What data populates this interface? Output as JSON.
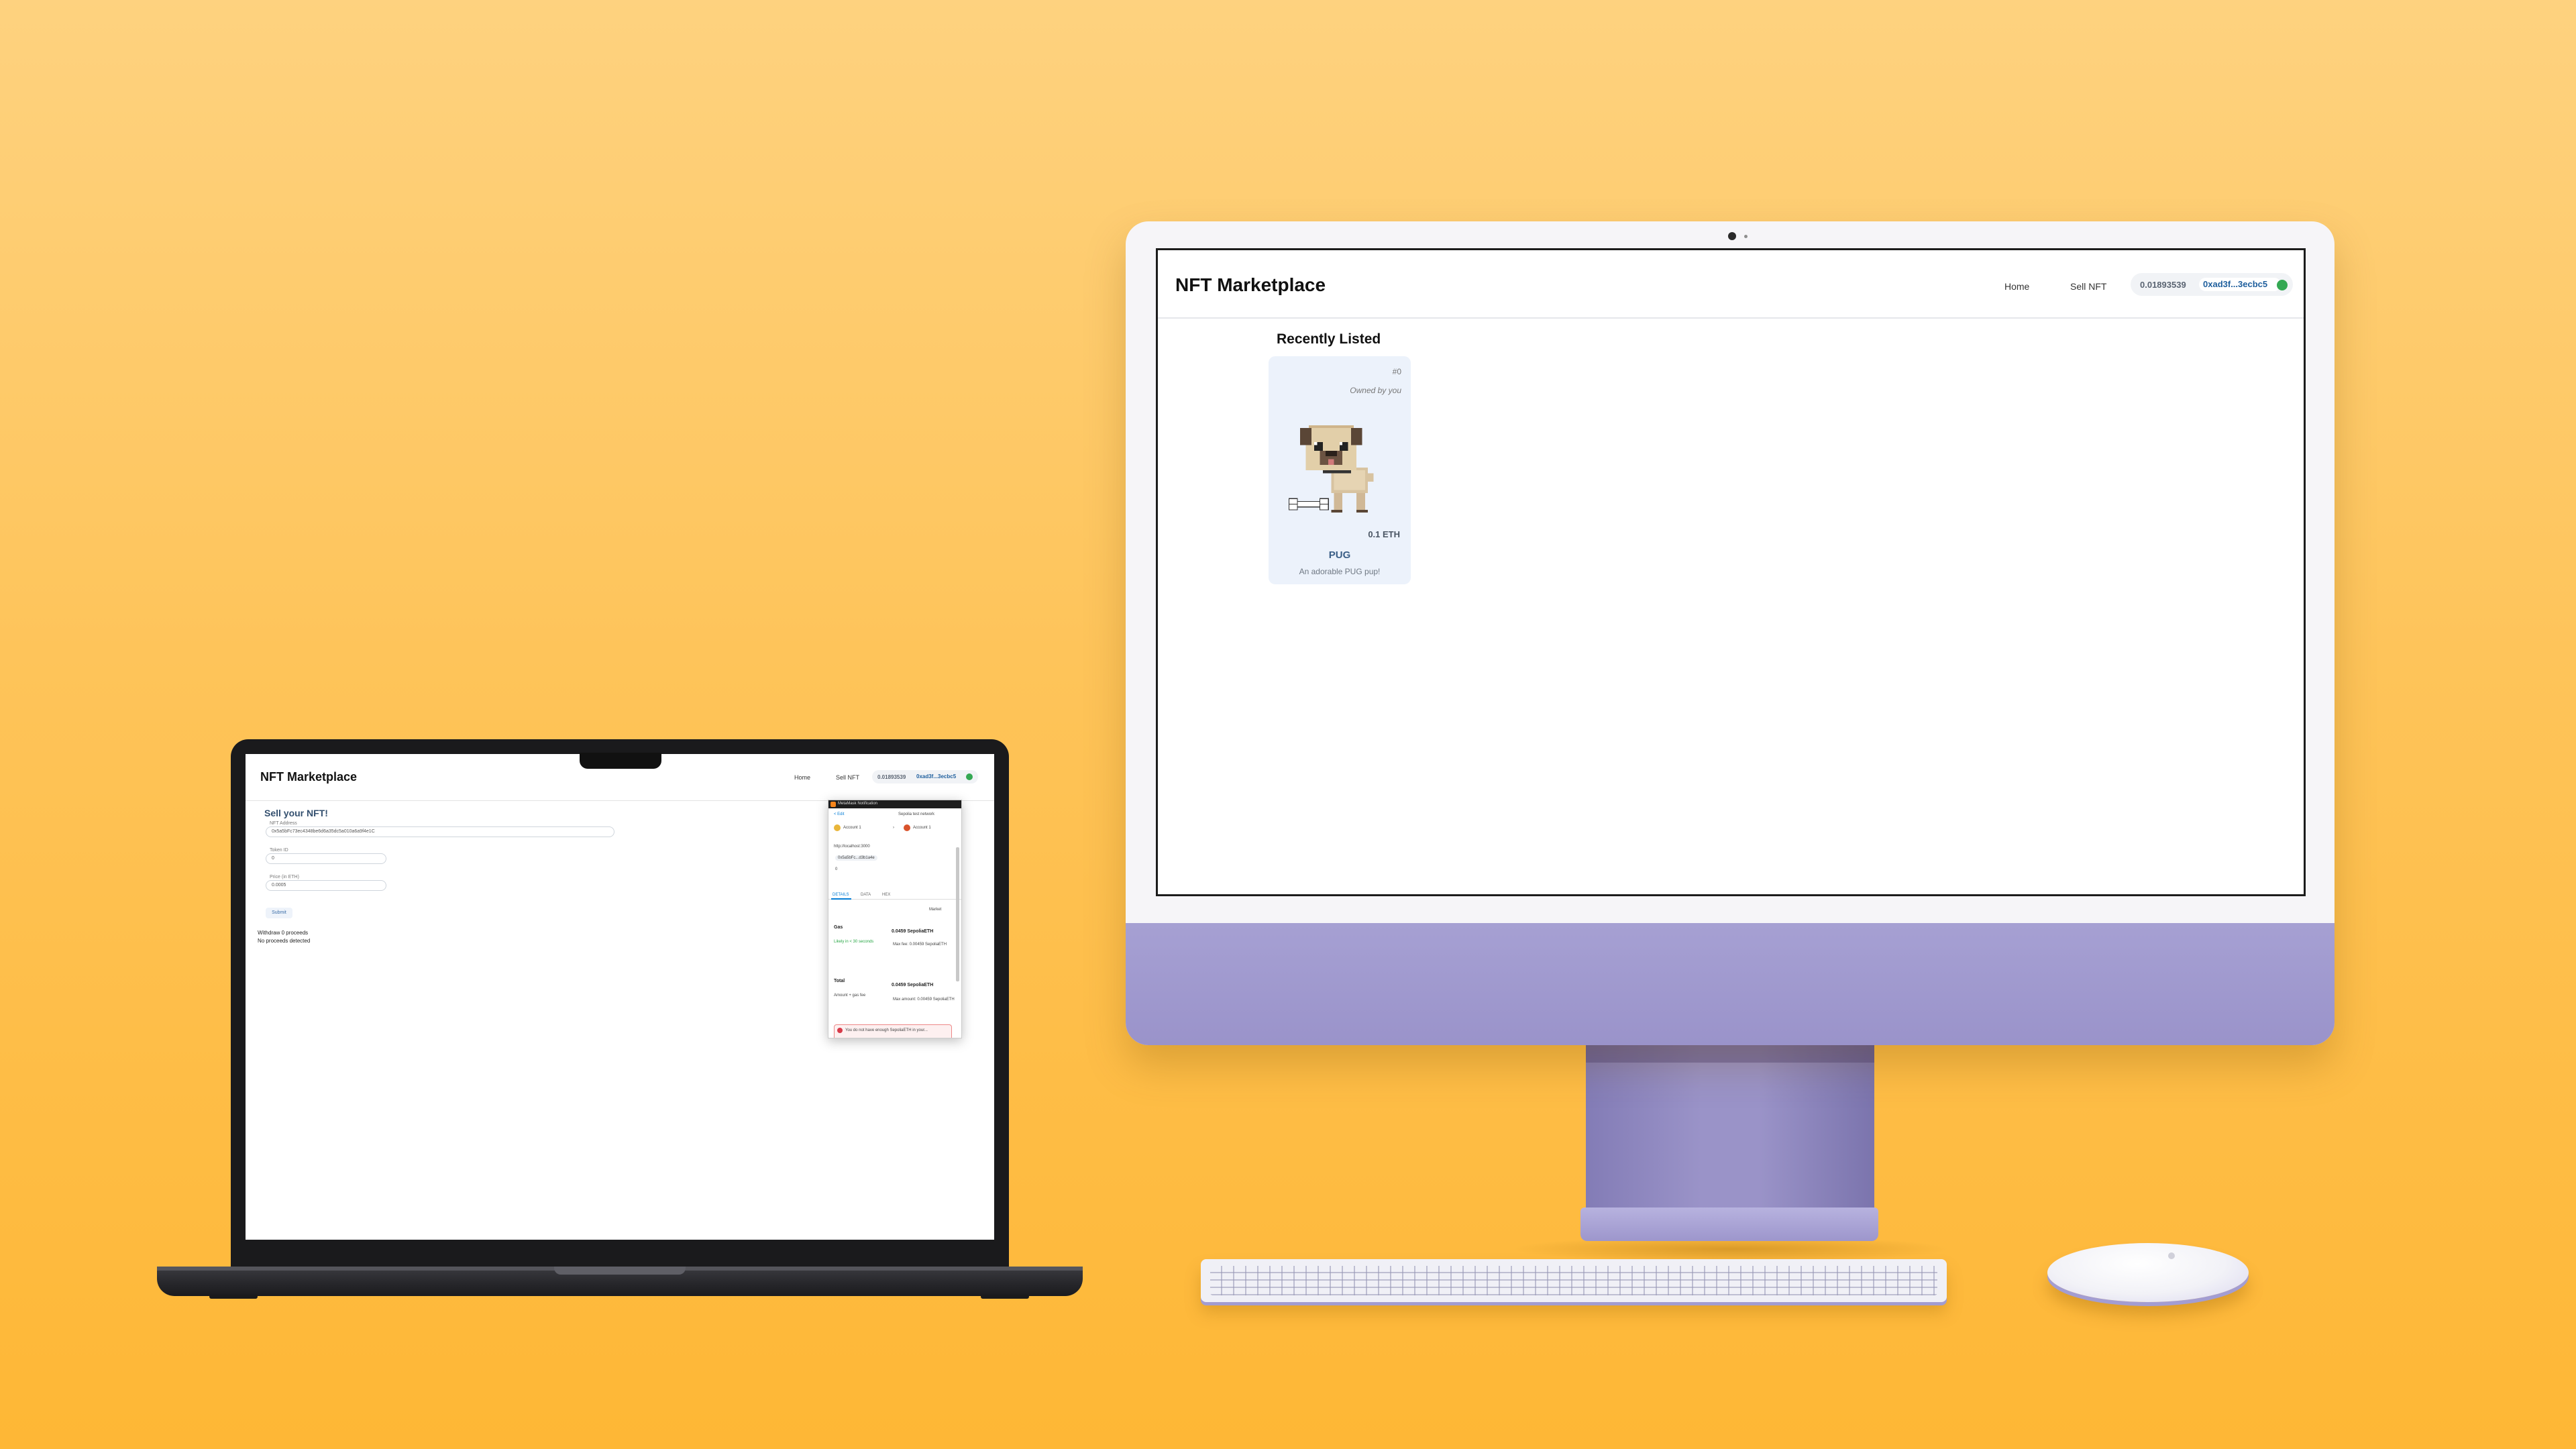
{
  "imac_app": {
    "title": "NFT Marketplace",
    "nav": {
      "home": "Home",
      "sell": "Sell NFT"
    },
    "wallet": {
      "balance": "0.01893539",
      "address": "0xad3f...3ecbc5"
    },
    "section_title": "Recently Listed",
    "card": {
      "token_id": "#0",
      "owner": "Owned by you",
      "price": "0.1 ETH",
      "name": "PUG",
      "description": "An adorable PUG pup!"
    }
  },
  "laptop_app": {
    "title": "NFT Marketplace",
    "nav": {
      "home": "Home",
      "sell": "Sell NFT"
    },
    "wallet": {
      "balance": "0.01893539",
      "address": "0xad3f...3ecbc5"
    },
    "form": {
      "title": "Sell your NFT!",
      "address_label": "NFT Address",
      "address_value": "0x5a5bFc73ec4348be6d6a35dc5a010a6a9f4e1C",
      "token_label": "Token ID",
      "token_value": "0",
      "price_label": "Price (in ETH)",
      "price_value": "0.0005",
      "submit": "Submit",
      "withdraw": "Withdraw 0 proceeds",
      "no_proceeds": "No proceeds detected"
    },
    "metamask": {
      "window_title": "MetaMask Notification",
      "edit": "< Edit",
      "network": "Sepolia test network",
      "account_from": "Account 1",
      "account_to": "Account 1",
      "site": "http://localhost:3000",
      "contract": "0x5a5bFc...d3b1a4e",
      "tabs": [
        "DETAILS",
        "DATA",
        "HEX"
      ],
      "market": "Market",
      "gas_label": "Gas",
      "gas_value": "0.0459 SepoliaETH",
      "likely": "Likely in < 30 seconds",
      "max_fee": "Max fee: 0.00459 SepoliaETH",
      "total_label": "Total",
      "total_value": "0.0459 SepoliaETH",
      "amount_label": "Amount + gas fee",
      "max_amount": "Max amount: 0.00459 SepoliaETH",
      "alert": "You do not have enough SepoliaETH in your..."
    }
  }
}
